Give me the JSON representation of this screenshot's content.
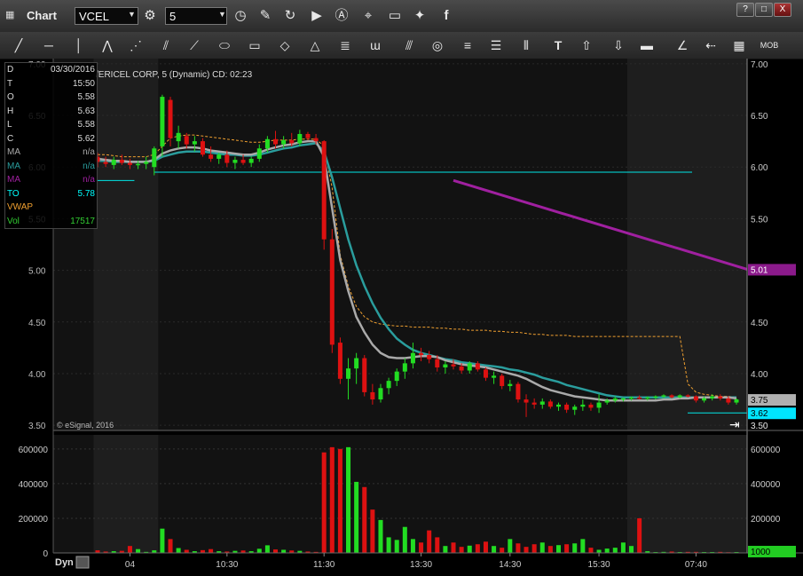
{
  "window": {
    "title": "Chart",
    "symbol_value": "VCEL",
    "interval_value": "5",
    "help_label": "?",
    "restore_label": "□",
    "close_label": "X"
  },
  "icons": {
    "titlebar": [
      "gear-icon",
      "clock-icon",
      "pencil-icon",
      "refresh-icon",
      "play-icon",
      "alert-icon",
      "link-icon",
      "comment-icon",
      "twitter-icon",
      "facebook-icon"
    ],
    "toolbar": [
      "line-tool",
      "hline-tool",
      "vline-tool",
      "polyline-tool",
      "fan-tool",
      "gann-tool",
      "ellipse-tool",
      "rectangle-tool",
      "eraser-tool",
      "triangle-tool",
      "channel-tool",
      "wave-tool",
      "parallel-tool",
      "circle-tool",
      "text-lines-tool",
      "cycle-tool",
      "text-tool",
      "arrow-up-tool",
      "arrow-down-tool",
      "bar-tool",
      "angle-tool",
      "back-arrow-tool",
      "grid-tool",
      "mob-tool"
    ]
  },
  "chart_header": "/ERICEL CORP, 5 (Dynamic) CD: 02:23",
  "watermark": "© eSignal, 2016",
  "data_window": {
    "rows": [
      {
        "k": "D",
        "v": "03/30/2016",
        "color": "#dddddd"
      },
      {
        "k": "T",
        "v": "15:50",
        "color": "#dddddd"
      },
      {
        "k": "O",
        "v": "5.58",
        "color": "#dddddd"
      },
      {
        "k": "H",
        "v": "5.63",
        "color": "#dddddd"
      },
      {
        "k": "L",
        "v": "5.58",
        "color": "#dddddd"
      },
      {
        "k": "C",
        "v": "5.62",
        "color": "#dddddd"
      },
      {
        "k": "MA",
        "v": "n/a",
        "color": "#aaaaaa"
      },
      {
        "k": "MA",
        "v": "n/a",
        "color": "#2a9d9d"
      },
      {
        "k": "MA",
        "v": "n/a",
        "color": "#a020a0"
      },
      {
        "k": "TO",
        "v": "5.78",
        "color": "#00ffff"
      },
      {
        "k": "VWAP",
        "v": "",
        "color": "#f0a030"
      },
      {
        "k": "Vol",
        "v": "17517",
        "color": "#32cd32"
      }
    ]
  },
  "bottom_bar": {
    "label": "Dyn"
  },
  "chart_data": {
    "type": "candlestick",
    "colors": {
      "up": "#22dd22",
      "down": "#dd1111",
      "ma_gray": "#aaaaaa",
      "ma_teal": "#2a9d9d",
      "trend": "#a020a0",
      "vwap": "#f0a030",
      "hline": "#00e5e5"
    },
    "price_axis": {
      "ylim": [
        3.45,
        7.05
      ],
      "ticks": [
        "7.00",
        "6.50",
        "6.00",
        "5.50",
        "5.00",
        "4.50",
        "4.00",
        "3.50"
      ],
      "tick_values": [
        7.0,
        6.5,
        6.0,
        5.5,
        5.0,
        4.5,
        4.0,
        3.5
      ]
    },
    "volume_axis": {
      "ylim": [
        0,
        640000
      ],
      "ticks": [
        "600000",
        "400000",
        "200000",
        "0"
      ],
      "tick_values": [
        600000,
        400000,
        200000,
        0
      ]
    },
    "time_labels": [
      {
        "label": "04",
        "x": 4
      },
      {
        "label": "10:30",
        "x": 16
      },
      {
        "label": "11:30",
        "x": 28
      },
      {
        "label": "13:30",
        "x": 40
      },
      {
        "label": "14:30",
        "x": 51
      },
      {
        "label": "15:30",
        "x": 62
      },
      {
        "label": "07:40",
        "x": 74
      }
    ],
    "shaded_ranges": [
      [
        0,
        7
      ],
      [
        66,
        80
      ]
    ],
    "candles": [
      {
        "o": 6.1,
        "h": 6.14,
        "l": 6.0,
        "c": 6.05
      },
      {
        "o": 6.05,
        "h": 6.1,
        "l": 6.0,
        "c": 6.03
      },
      {
        "o": 6.02,
        "h": 6.1,
        "l": 5.98,
        "c": 6.07
      },
      {
        "o": 6.07,
        "h": 6.12,
        "l": 6.02,
        "c": 6.04
      },
      {
        "o": 6.04,
        "h": 6.08,
        "l": 5.98,
        "c": 6.02
      },
      {
        "o": 6.02,
        "h": 6.06,
        "l": 5.98,
        "c": 6.03
      },
      {
        "o": 6.03,
        "h": 6.1,
        "l": 5.98,
        "c": 6.05
      },
      {
        "o": 6.0,
        "h": 6.2,
        "l": 5.92,
        "c": 6.18
      },
      {
        "o": 6.2,
        "h": 6.7,
        "l": 6.1,
        "c": 6.68
      },
      {
        "o": 6.65,
        "h": 6.68,
        "l": 6.2,
        "c": 6.28
      },
      {
        "o": 6.25,
        "h": 6.4,
        "l": 6.18,
        "c": 6.33
      },
      {
        "o": 6.3,
        "h": 6.33,
        "l": 6.18,
        "c": 6.22
      },
      {
        "o": 6.22,
        "h": 6.3,
        "l": 6.15,
        "c": 6.25
      },
      {
        "o": 6.25,
        "h": 6.28,
        "l": 6.1,
        "c": 6.12
      },
      {
        "o": 6.12,
        "h": 6.2,
        "l": 6.05,
        "c": 6.08
      },
      {
        "o": 6.08,
        "h": 6.14,
        "l": 6.03,
        "c": 6.12
      },
      {
        "o": 6.12,
        "h": 6.16,
        "l": 6.0,
        "c": 6.04
      },
      {
        "o": 6.04,
        "h": 6.1,
        "l": 5.98,
        "c": 6.07
      },
      {
        "o": 6.07,
        "h": 6.12,
        "l": 6.02,
        "c": 6.04
      },
      {
        "o": 6.04,
        "h": 6.1,
        "l": 6.0,
        "c": 6.08
      },
      {
        "o": 6.08,
        "h": 6.22,
        "l": 6.05,
        "c": 6.18
      },
      {
        "o": 6.18,
        "h": 6.3,
        "l": 6.14,
        "c": 6.27
      },
      {
        "o": 6.27,
        "h": 6.35,
        "l": 6.18,
        "c": 6.22
      },
      {
        "o": 6.22,
        "h": 6.3,
        "l": 6.18,
        "c": 6.26
      },
      {
        "o": 6.26,
        "h": 6.33,
        "l": 6.2,
        "c": 6.23
      },
      {
        "o": 6.23,
        "h": 6.36,
        "l": 6.2,
        "c": 6.32
      },
      {
        "o": 6.32,
        "h": 6.34,
        "l": 6.26,
        "c": 6.28
      },
      {
        "o": 6.28,
        "h": 6.32,
        "l": 6.22,
        "c": 6.25
      },
      {
        "o": 6.25,
        "h": 6.26,
        "l": 5.2,
        "c": 5.3
      },
      {
        "o": 5.3,
        "h": 5.4,
        "l": 4.2,
        "c": 4.28
      },
      {
        "o": 4.3,
        "h": 4.35,
        "l": 3.9,
        "c": 3.95
      },
      {
        "o": 3.95,
        "h": 4.15,
        "l": 3.75,
        "c": 4.05
      },
      {
        "o": 4.05,
        "h": 4.2,
        "l": 3.9,
        "c": 4.15
      },
      {
        "o": 4.15,
        "h": 4.18,
        "l": 3.78,
        "c": 3.82
      },
      {
        "o": 3.82,
        "h": 3.9,
        "l": 3.7,
        "c": 3.75
      },
      {
        "o": 3.75,
        "h": 3.9,
        "l": 3.72,
        "c": 3.86
      },
      {
        "o": 3.86,
        "h": 3.96,
        "l": 3.8,
        "c": 3.93
      },
      {
        "o": 3.93,
        "h": 4.05,
        "l": 3.88,
        "c": 4.02
      },
      {
        "o": 4.02,
        "h": 4.15,
        "l": 3.95,
        "c": 4.1
      },
      {
        "o": 4.1,
        "h": 4.3,
        "l": 4.05,
        "c": 4.2
      },
      {
        "o": 4.2,
        "h": 4.25,
        "l": 4.12,
        "c": 4.18
      },
      {
        "o": 4.18,
        "h": 4.22,
        "l": 4.1,
        "c": 4.14
      },
      {
        "o": 4.14,
        "h": 4.18,
        "l": 4.02,
        "c": 4.06
      },
      {
        "o": 4.06,
        "h": 4.12,
        "l": 4.0,
        "c": 4.09
      },
      {
        "o": 4.09,
        "h": 4.14,
        "l": 4.04,
        "c": 4.07
      },
      {
        "o": 4.07,
        "h": 4.1,
        "l": 4.0,
        "c": 4.03
      },
      {
        "o": 4.03,
        "h": 4.12,
        "l": 4.0,
        "c": 4.1
      },
      {
        "o": 4.1,
        "h": 4.12,
        "l": 4.02,
        "c": 4.04
      },
      {
        "o": 4.04,
        "h": 4.06,
        "l": 3.93,
        "c": 3.96
      },
      {
        "o": 3.96,
        "h": 4.02,
        "l": 3.9,
        "c": 3.98
      },
      {
        "o": 3.98,
        "h": 4.0,
        "l": 3.85,
        "c": 3.88
      },
      {
        "o": 3.88,
        "h": 3.94,
        "l": 3.83,
        "c": 3.9
      },
      {
        "o": 3.9,
        "h": 3.92,
        "l": 3.72,
        "c": 3.75
      },
      {
        "o": 3.75,
        "h": 3.8,
        "l": 3.58,
        "c": 3.72
      },
      {
        "o": 3.72,
        "h": 3.76,
        "l": 3.66,
        "c": 3.7
      },
      {
        "o": 3.7,
        "h": 3.76,
        "l": 3.66,
        "c": 3.73
      },
      {
        "o": 3.73,
        "h": 3.75,
        "l": 3.66,
        "c": 3.68
      },
      {
        "o": 3.68,
        "h": 3.72,
        "l": 3.64,
        "c": 3.7
      },
      {
        "o": 3.7,
        "h": 3.72,
        "l": 3.62,
        "c": 3.65
      },
      {
        "o": 3.65,
        "h": 3.7,
        "l": 3.6,
        "c": 3.68
      },
      {
        "o": 3.68,
        "h": 3.75,
        "l": 3.64,
        "c": 3.7
      },
      {
        "o": 3.7,
        "h": 3.72,
        "l": 3.64,
        "c": 3.67
      },
      {
        "o": 3.67,
        "h": 3.8,
        "l": 3.62,
        "c": 3.72
      },
      {
        "o": 3.72,
        "h": 3.76,
        "l": 3.7,
        "c": 3.74
      },
      {
        "o": 3.74,
        "h": 3.78,
        "l": 3.72,
        "c": 3.76
      },
      {
        "o": 3.75,
        "h": 3.77,
        "l": 3.73,
        "c": 3.76
      },
      {
        "o": 3.76,
        "h": 3.78,
        "l": 3.74,
        "c": 3.77
      },
      {
        "o": 3.77,
        "h": 3.79,
        "l": 3.75,
        "c": 3.76
      },
      {
        "o": 3.76,
        "h": 3.78,
        "l": 3.74,
        "c": 3.77
      },
      {
        "o": 3.77,
        "h": 3.79,
        "l": 3.75,
        "c": 3.78
      },
      {
        "o": 3.78,
        "h": 3.8,
        "l": 3.76,
        "c": 3.79
      },
      {
        "o": 3.79,
        "h": 3.8,
        "l": 3.76,
        "c": 3.77
      },
      {
        "o": 3.77,
        "h": 3.8,
        "l": 3.76,
        "c": 3.79
      },
      {
        "o": 3.79,
        "h": 3.8,
        "l": 3.77,
        "c": 3.78
      },
      {
        "o": 3.78,
        "h": 3.79,
        "l": 3.72,
        "c": 3.74
      },
      {
        "o": 3.74,
        "h": 3.78,
        "l": 3.72,
        "c": 3.76
      },
      {
        "o": 3.76,
        "h": 3.8,
        "l": 3.74,
        "c": 3.78
      },
      {
        "o": 3.78,
        "h": 3.8,
        "l": 3.74,
        "c": 3.76
      },
      {
        "o": 3.76,
        "h": 3.78,
        "l": 3.7,
        "c": 3.72
      },
      {
        "o": 3.72,
        "h": 3.76,
        "l": 3.7,
        "c": 3.75
      }
    ],
    "volume": [
      15000,
      8000,
      10000,
      12000,
      40000,
      22000,
      6000,
      15000,
      140000,
      80000,
      28000,
      18000,
      10000,
      16000,
      22000,
      10000,
      8000,
      12000,
      14000,
      10000,
      24000,
      44000,
      20000,
      18000,
      14000,
      12000,
      8000,
      6000,
      580000,
      610000,
      600000,
      610000,
      410000,
      380000,
      250000,
      190000,
      90000,
      75000,
      150000,
      80000,
      60000,
      130000,
      90000,
      40000,
      60000,
      35000,
      42000,
      50000,
      65000,
      40000,
      30000,
      80000,
      55000,
      35000,
      50000,
      60000,
      40000,
      45000,
      50000,
      55000,
      80000,
      30000,
      18000,
      25000,
      30000,
      60000,
      40000,
      200000,
      10000,
      5000,
      6000,
      8000,
      5000,
      6000,
      6000,
      5000,
      5000,
      6000,
      4000,
      5000
    ],
    "ma_gray": [
      6.08,
      6.07,
      6.06,
      6.06,
      6.05,
      6.05,
      6.05,
      6.07,
      6.13,
      6.16,
      6.18,
      6.19,
      6.19,
      6.18,
      6.16,
      6.15,
      6.14,
      6.13,
      6.12,
      6.12,
      6.14,
      6.17,
      6.19,
      6.21,
      6.22,
      6.24,
      6.25,
      6.25,
      6.1,
      5.6,
      5.1,
      4.8,
      4.55,
      4.4,
      4.28,
      4.2,
      4.16,
      4.15,
      4.15,
      4.16,
      4.17,
      4.17,
      4.16,
      4.13,
      4.11,
      4.09,
      4.08,
      4.07,
      4.06,
      4.04,
      4.02,
      4.0,
      3.98,
      3.95,
      3.91,
      3.87,
      3.84,
      3.82,
      3.8,
      3.78,
      3.77,
      3.76,
      3.75,
      3.74,
      3.74,
      3.74,
      3.74,
      3.74,
      3.74,
      3.74,
      3.75,
      3.75,
      3.76,
      3.76,
      3.77,
      3.77,
      3.77,
      3.77,
      3.77,
      3.76
    ],
    "ma_teal": [
      6.06,
      6.06,
      6.05,
      6.05,
      6.05,
      6.05,
      6.05,
      6.06,
      6.1,
      6.12,
      6.14,
      6.15,
      6.15,
      6.15,
      6.14,
      6.13,
      6.12,
      6.12,
      6.11,
      6.11,
      6.12,
      6.14,
      6.16,
      6.18,
      6.19,
      6.21,
      6.22,
      6.23,
      6.15,
      5.9,
      5.6,
      5.3,
      5.05,
      4.85,
      4.68,
      4.54,
      4.43,
      4.34,
      4.28,
      4.23,
      4.2,
      4.18,
      4.16,
      4.14,
      4.13,
      4.11,
      4.1,
      4.09,
      4.08,
      4.07,
      4.06,
      4.04,
      4.03,
      4.01,
      3.99,
      3.96,
      3.94,
      3.92,
      3.89,
      3.87,
      3.85,
      3.83,
      3.81,
      3.79,
      3.78,
      3.77,
      3.77,
      3.77,
      3.77,
      3.77,
      3.77,
      3.77,
      3.77,
      3.77,
      3.77,
      3.77,
      3.77,
      3.77,
      3.77,
      3.77
    ],
    "vwap": [
      6.12,
      6.12,
      6.11,
      6.1,
      6.1,
      6.1,
      6.1,
      6.12,
      6.2,
      6.28,
      6.3,
      6.31,
      6.31,
      6.3,
      6.29,
      6.28,
      6.27,
      6.26,
      6.25,
      6.24,
      6.24,
      6.25,
      6.26,
      6.26,
      6.26,
      6.27,
      6.27,
      6.27,
      6.2,
      5.8,
      5.15,
      4.85,
      4.65,
      4.55,
      4.5,
      4.48,
      4.47,
      4.46,
      4.46,
      4.45,
      4.45,
      4.45,
      4.44,
      4.44,
      4.43,
      4.43,
      4.42,
      4.42,
      4.42,
      4.41,
      4.41,
      4.4,
      4.4,
      4.39,
      4.38,
      4.38,
      4.37,
      4.37,
      4.37,
      4.36,
      4.36,
      4.36,
      4.36,
      4.36,
      4.36,
      4.36,
      4.36,
      4.36,
      4.36,
      4.36,
      4.36,
      4.36,
      4.36,
      3.9,
      3.82,
      3.8,
      3.79,
      3.78,
      3.78,
      3.77
    ],
    "hline_level": 5.95,
    "hline_short_level": 5.87,
    "trendline": {
      "x1": 44,
      "y1": 5.87,
      "x2": 80,
      "y2": 5.01
    },
    "badges": [
      {
        "text": "5.01",
        "value": 5.01,
        "bg": "#8b1a8b",
        "fg": "#ffffff"
      },
      {
        "text": "3.75",
        "value": 3.75,
        "bg": "#b0b0b0",
        "fg": "#000000"
      },
      {
        "text": "3.62",
        "value": 3.62,
        "bg": "#00e5ff",
        "fg": "#000000"
      },
      {
        "text": "3.50",
        "value": 3.5,
        "bg": "",
        "fg": "#cccccc"
      }
    ],
    "volume_badge": {
      "text": "1000",
      "bg": "#22cc22",
      "fg": "#000000"
    },
    "last_price_marker": 3.62
  }
}
